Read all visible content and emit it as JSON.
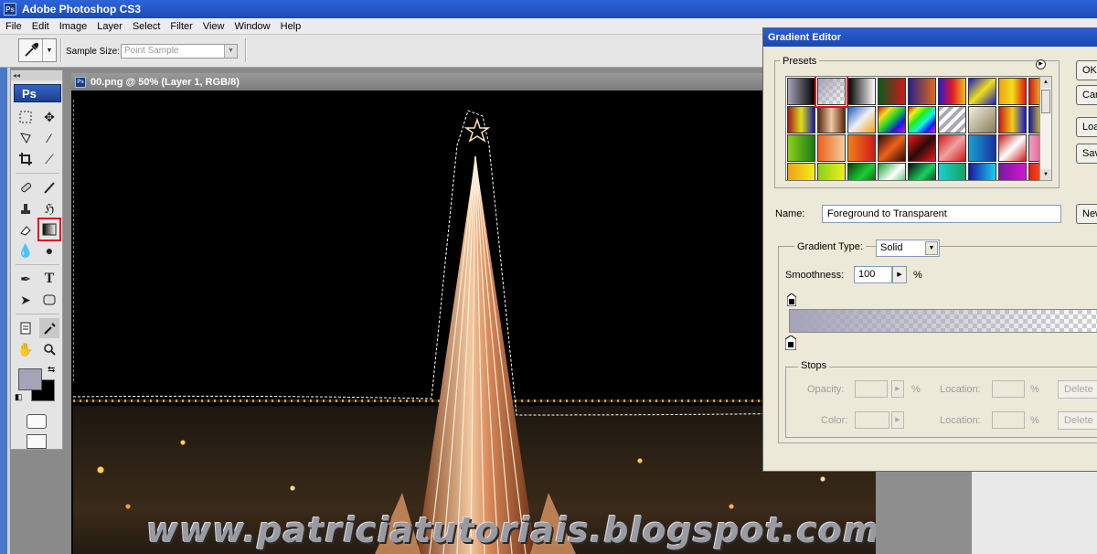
{
  "app": {
    "title": "Adobe Photoshop CS3",
    "logo": "Ps"
  },
  "menu": [
    "File",
    "Edit",
    "Image",
    "Layer",
    "Select",
    "Filter",
    "View",
    "Window",
    "Help"
  ],
  "options": {
    "tool_icon": "eyedropper-icon",
    "sample_size_label": "Sample Size:",
    "sample_size_value": "Point Sample"
  },
  "toolbox": {
    "logo": "Ps",
    "collapse": "◂◂",
    "highlighted_tool": "gradient-tool",
    "foreground_color": "#a5a3b8",
    "background_color": "#000000"
  },
  "document": {
    "title": "00.png @ 50% (Layer 1, RGB/8)",
    "watermark": "www.patriciatutoriais.blogspot.com"
  },
  "gradient_editor": {
    "title": "Gradient Editor",
    "presets_label": "Presets",
    "selected_preset_index": 1,
    "name_label": "Name:",
    "name_value": "Foreground to Transparent",
    "gradient_type_label": "Gradient Type:",
    "gradient_type_value": "Solid",
    "smoothness_label": "Smoothness:",
    "smoothness_value": "100",
    "smoothness_unit": "%",
    "stops_label": "Stops",
    "opacity_label": "Opacity:",
    "opacity_unit": "%",
    "color_label": "Color:",
    "location_label": "Location:",
    "location_unit": "%",
    "delete_label": "Delete",
    "side_buttons": [
      "OK",
      "Cancel",
      "Load...",
      "Save...",
      "New"
    ],
    "accent_color": "#e0101a"
  }
}
